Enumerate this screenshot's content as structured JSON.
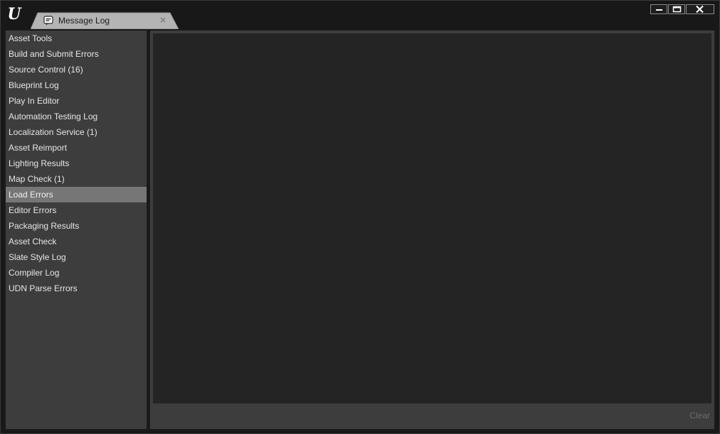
{
  "app": {
    "logo_text": "U"
  },
  "tab": {
    "label": "Message Log",
    "close_symbol": "×"
  },
  "window_controls": {
    "minimize": "minimize",
    "maximize": "maximize",
    "close": "close"
  },
  "sidebar": {
    "selected_index": 10,
    "items": [
      {
        "label": "Asset Tools"
      },
      {
        "label": "Build and Submit Errors"
      },
      {
        "label": "Source Control (16)"
      },
      {
        "label": "Blueprint Log"
      },
      {
        "label": "Play In Editor"
      },
      {
        "label": "Automation Testing Log"
      },
      {
        "label": "Localization Service (1)"
      },
      {
        "label": "Asset Reimport"
      },
      {
        "label": "Lighting Results"
      },
      {
        "label": "Map Check (1)"
      },
      {
        "label": "Load Errors"
      },
      {
        "label": "Editor Errors"
      },
      {
        "label": "Packaging Results"
      },
      {
        "label": "Asset Check"
      },
      {
        "label": "Slate Style Log"
      },
      {
        "label": "Compiler Log"
      },
      {
        "label": "UDN Parse Errors"
      }
    ]
  },
  "main": {
    "clear_label": "Clear"
  },
  "colors": {
    "background": "#181818",
    "panel": "#3d3d3d",
    "log_area": "#242424",
    "selected_item": "#767676",
    "tab": "#b4b4b4"
  }
}
